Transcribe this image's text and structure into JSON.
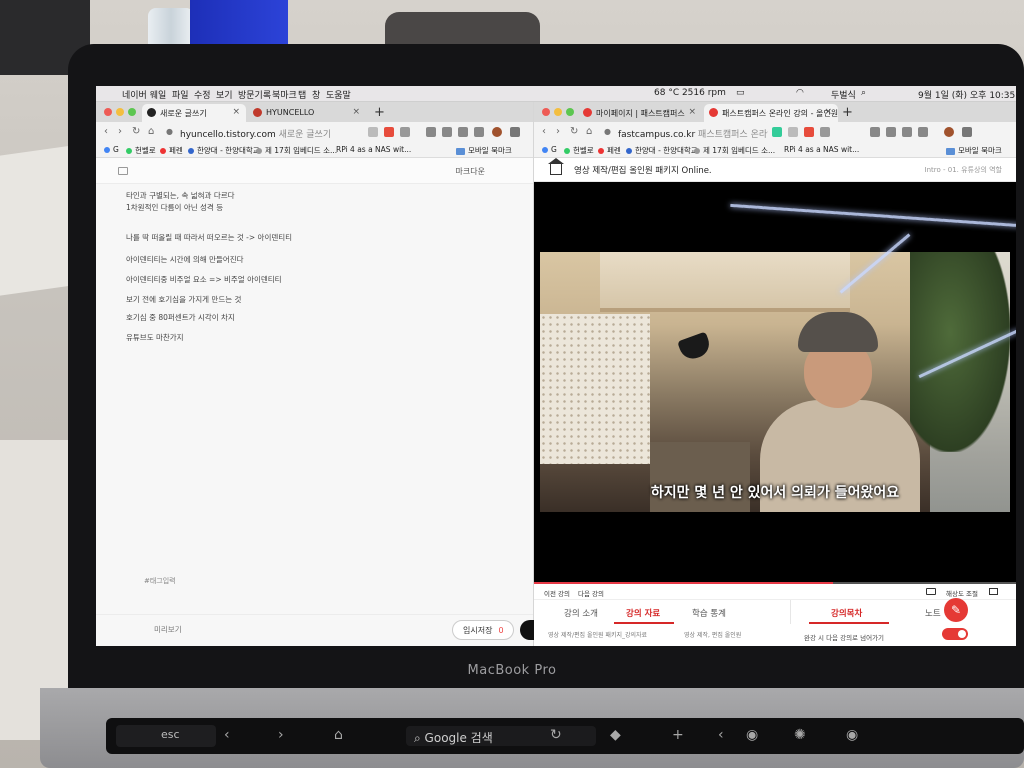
{
  "menubar": {
    "app": "네이버 웨일",
    "items": [
      "파일",
      "수정",
      "보기",
      "방문기록",
      "북마크",
      "탭",
      "창",
      "도움말"
    ],
    "temp": "68 °C 2516 rpm",
    "input_source": "두벌식",
    "datetime": "9월 1일 (화) 오후 10:35"
  },
  "left": {
    "tabs": [
      {
        "label": "새로운 글쓰기"
      },
      {
        "label": "HYUNCELLO"
      }
    ],
    "url_host": "hyuncello.tistory.com",
    "url_rest": " 새로운 글쓰기",
    "bookmarks": [
      "G",
      "헌벨로",
      "페렌",
      "한양대 - 한양대학교",
      "제 17회 임베디드 소...",
      "RPi 4 as a NAS wit..."
    ],
    "mobile_bookmarks": "모바일 북마크",
    "editor_mode": "마크다운",
    "lines": [
      "타인과 구별되는, 속 넓혀과 다르다",
      "1차원적인 다름이 아닌 성격 등",
      "나를 딱 떠올릴 때 따라서 떠오르는 것 -> 아이덴티티",
      "아이덴티티는 시간에 의해 만들어진다",
      "아이덴티티중 비주얼 요소 => 비주얼 아이덴티티",
      "보기 전에 호기심을 가지게 만드는 것",
      "호기심 중 80퍼센트가 시각이 차지",
      "유튜브도 마찬가지"
    ],
    "tag_placeholder": "#태그입력",
    "preview": "미리보기",
    "save_label": "임시저장",
    "save_count": "0"
  },
  "right": {
    "tabs": [
      {
        "label": "마이페이지 | 패스트캠퍼스"
      },
      {
        "label": "패스트캠퍼스 온라인 강의 - 올인원"
      }
    ],
    "url_host": "fastcampus.co.kr",
    "url_rest": " 패스트캠퍼스 온라인",
    "bookmarks": [
      "G",
      "헌벨로",
      "페렌",
      "한양대 - 한양대학교",
      "제 17회 임베디드 소...",
      "RPi 4 as a NAS wit..."
    ],
    "mobile_bookmarks": "모바일 북마크",
    "course_title": "영상 제작/편집 올인원 패키지 Online.",
    "breadcrumb": "Intro - 01. 유튜상의 역할",
    "subtitle": "하지만 몇 년 안 있어서 의뢰가 들어왔어요",
    "progress": 0.62,
    "prev_lecture": "이전 강의",
    "next_lecture": "다음 강의",
    "quality": "해상도 조절",
    "lecture_tabs": [
      "강의 소개",
      "강의 자료",
      "학습 통계"
    ],
    "side_tabs": [
      "강의목차",
      "노트"
    ],
    "material_1": "영상 제작/편집 올인원 패키지_강의자료",
    "material_2": "영상 제작, 편집 올인원",
    "autoplay": "완강 시 다음 강의로 넘어가기",
    "autoplay_on": true
  },
  "laptop": {
    "brand": "MacBook Pro",
    "esc": "esc",
    "touchbar_search": "Google 검색"
  },
  "colors": {
    "accent": "#d62828",
    "toggle": "#e53935"
  }
}
